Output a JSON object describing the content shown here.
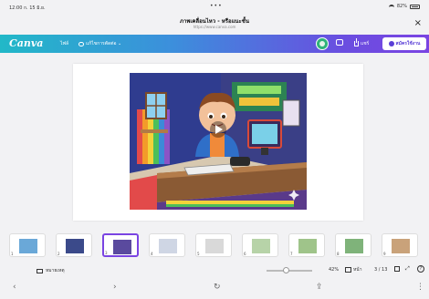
{
  "status": {
    "time": "12:00  ก. 15 มิ.ย.",
    "dots": "•••",
    "battery": "82%"
  },
  "header": {
    "title": "ภาพเคลื่อนไหว - หรือแนะชั้น",
    "url": "https://www.canva.com",
    "close_icon": "×"
  },
  "toolbar": {
    "logo": "Canva",
    "file_label": "ไฟล์",
    "edit_mode_label": "แก้ไขการตัดต่อ ⌄",
    "share_label": "แชร์",
    "pro_label": "สมัครใช้งาน"
  },
  "thumbnails": [
    {
      "num": "1",
      "color": "#6aa8d8"
    },
    {
      "num": "2",
      "color": "#3b4a8a"
    },
    {
      "num": "3",
      "color": "#5a4a9e",
      "selected": true
    },
    {
      "num": "4",
      "color": "#cfd6e4"
    },
    {
      "num": "5",
      "color": "#d9d9d9"
    },
    {
      "num": "6",
      "color": "#b7d3a8"
    },
    {
      "num": "7",
      "color": "#9fc48a"
    },
    {
      "num": "8",
      "color": "#7fb37a"
    },
    {
      "num": "9",
      "color": "#c9a27a"
    }
  ],
  "bottombar": {
    "notes_label": "หมายเหตุ",
    "zoom_level": 42,
    "zoom_label": "42%",
    "pages_label": "หน้า",
    "page_info": "3 / 13",
    "help_label": "?"
  },
  "navbar": {
    "back": "‹",
    "forward": "›",
    "reload": "↻",
    "share": "⇪",
    "more": "⋮"
  }
}
